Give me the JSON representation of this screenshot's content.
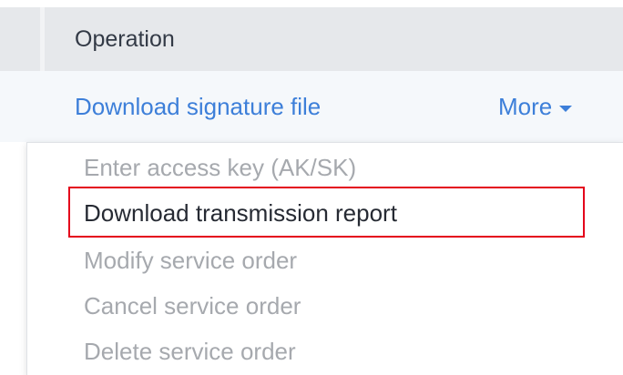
{
  "table": {
    "header": {
      "operation_label": "Operation"
    },
    "row": {
      "download_signature_label": "Download signature file",
      "more_label": "More"
    }
  },
  "dropdown": {
    "items": [
      {
        "label": "Enter access key (AK/SK)",
        "enabled": false
      },
      {
        "label": "Download transmission report",
        "enabled": true,
        "highlighted": true
      },
      {
        "label": "Modify service order",
        "enabled": false
      },
      {
        "label": "Cancel service order",
        "enabled": false
      },
      {
        "label": "Delete service order",
        "enabled": false
      }
    ]
  },
  "colors": {
    "link": "#3d7fd9",
    "header_bg": "#e6e8eb",
    "row_bg": "#f5f8fb",
    "disabled_text": "#a6a9ae",
    "enabled_text": "#262a33",
    "highlight_border": "#e4001b"
  },
  "icons": {
    "more_caret": "caret-down-icon"
  }
}
